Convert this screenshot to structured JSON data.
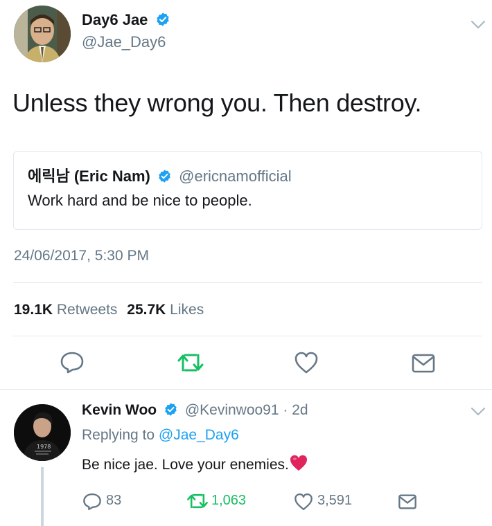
{
  "tweet": {
    "display_name": "Day6 Jae",
    "handle": "@Jae_Day6",
    "text": "Unless they wrong you. Then destroy.",
    "timestamp": "24/06/2017, 5:30 PM",
    "quoted": {
      "display_name": "에릭남 (Eric Nam)",
      "handle": "@ericnamofficial",
      "text": "Work hard and be nice to people."
    },
    "stats": {
      "retweets_count": "19.1K",
      "retweets_label": "Retweets",
      "likes_count": "25.7K",
      "likes_label": "Likes"
    }
  },
  "reply": {
    "display_name": "Kevin Woo",
    "handle": "@Kevinwoo91",
    "separator": "·",
    "age": "2d",
    "replying_prefix": "Replying to",
    "replying_handle": "@Jae_Day6",
    "text": "Be nice jae. Love your enemies.",
    "emoji": "❤️",
    "reply_count": "83",
    "retweet_count": "1,063",
    "like_count": "3,591"
  },
  "colors": {
    "verified": "#1da1f2",
    "retweet_active": "#17bf63",
    "text_muted": "#657786",
    "link": "#1da1f2",
    "heart": "#e0245e"
  },
  "icons": [
    "verified-badge-icon",
    "chevron-down-icon",
    "reply-icon",
    "retweet-icon",
    "like-icon",
    "direct-message-icon"
  ]
}
